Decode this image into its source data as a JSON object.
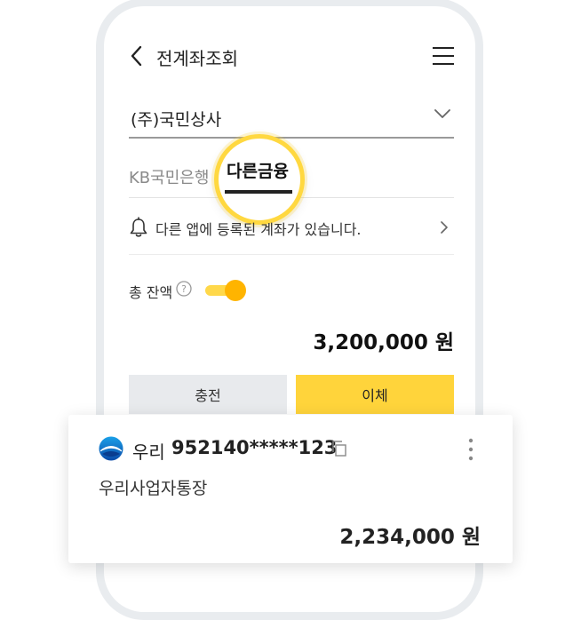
{
  "header": {
    "title": "전계좌조회"
  },
  "company": {
    "name": "(주)국민상사"
  },
  "tabs": [
    {
      "label": "KB국민은행",
      "active": false
    },
    {
      "label": "다른금융",
      "active": true
    }
  ],
  "notice": {
    "text": "다른 앱에 등록된 계좌가 있습니다."
  },
  "balance": {
    "label": "총 잔액",
    "amount": "3,200,000 원",
    "toggle_on": true
  },
  "buttons": {
    "charge": "충전",
    "transfer": "이체"
  },
  "account_card": {
    "bank": "우리",
    "account_number": "952140*****123",
    "account_type": "우리사업자통장",
    "amount": "2,234,000 원"
  },
  "colors": {
    "accent": "#ffd43b",
    "toggle_knob": "#ffb400",
    "spotlight_ring": "#ffd840"
  },
  "icons": [
    "back-icon",
    "menu-icon",
    "chevron-down-icon",
    "bell-icon",
    "chevron-right-icon",
    "help-icon",
    "bank-logo-icon",
    "copy-icon",
    "kebab-icon"
  ]
}
